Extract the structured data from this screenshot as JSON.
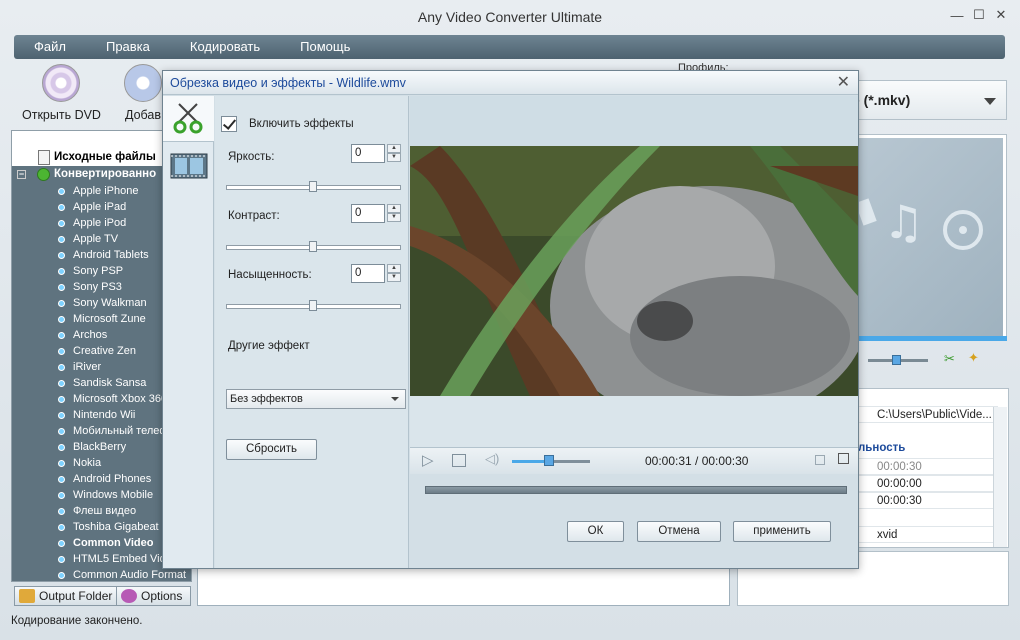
{
  "window": {
    "title": "Any Video Converter Ultimate"
  },
  "menu": [
    "Файл",
    "Правка",
    "Кодировать",
    "Помощь"
  ],
  "toolbar": {
    "open_dvd": "Открыть DVD",
    "add": "Добав"
  },
  "profile": {
    "label": "Профиль:",
    "value": "ie (*.mkv)"
  },
  "tree": {
    "source_files": "Исходные файлы",
    "converted": "Конвертированно",
    "items": [
      "Apple iPhone",
      "Apple iPad",
      "Apple iPod",
      "Apple TV",
      "Android Tablets",
      "Sony PSP",
      "Sony PS3",
      "Sony Walkman",
      "Microsoft Zune",
      "Archos",
      "Creative Zen",
      "iRiver",
      "Sandisk Sansa",
      "Microsoft Xbox 360",
      "Nintendo Wii",
      "Мобильный телеф",
      "BlackBerry",
      "Nokia",
      "Android Phones",
      "Windows Mobile",
      "Флеш видео",
      "Toshiba Gigabeat",
      "Common Video",
      "HTML5 Embed Vide",
      "Common Audio Format"
    ],
    "bold_items": [
      "Common Video"
    ]
  },
  "buttons": {
    "output_folder": "Output Folder",
    "options": "Options"
  },
  "properties": {
    "path": "C:\\Users\\Public\\Vide...",
    "section": "льность",
    "duration": "00:00:30",
    "start": "00:00:00",
    "end": "00:00:30",
    "codec": "xvid"
  },
  "status": "Кодирование закончено.",
  "dialog": {
    "title": "Обрезка видео и эффекты - Wildlife.wmv",
    "enable_effects": "Включить эффекты",
    "brightness_label": "Яркость:",
    "brightness": "0",
    "contrast_label": "Контраст:",
    "contrast": "0",
    "saturation_label": "Насыщенность:",
    "saturation": "0",
    "other_effects_label": "Другие эффект",
    "other_effects_value": "Без эффектов",
    "reset": "Сбросить",
    "time": "00:00:31 / 00:00:30",
    "ok": "ОК",
    "cancel": "Отмена",
    "apply": "применить"
  },
  "colors": {
    "accent": "#4aa8e8",
    "title_blue": "#1c4a9b",
    "tree_bg": "#5f737f"
  }
}
